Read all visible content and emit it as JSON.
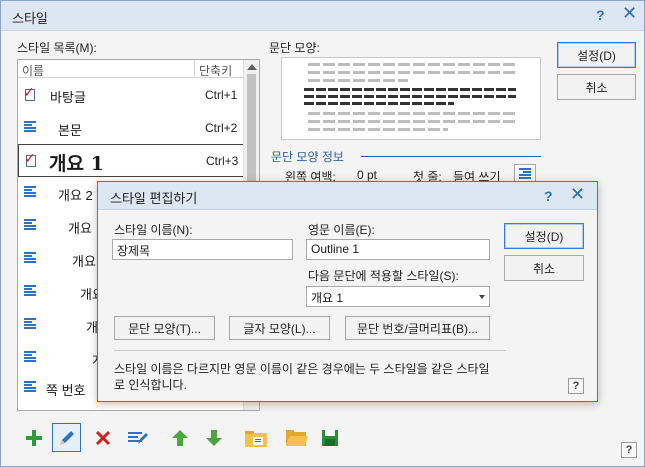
{
  "outer": {
    "title": "스타일",
    "help": "?",
    "close": "✕",
    "list_label": "스타일 목록(M):",
    "list_header_name": "이름",
    "list_header_key": "단축키",
    "preview_label": "문단 모양:",
    "ok_label": "설정(D)",
    "cancel_label": "취소",
    "info_title": "문단 모양 정보",
    "info_left_margin_label": "왼쪽 여백:",
    "info_left_margin_value": "0 pt",
    "info_first_line_label": "첫 줄:",
    "info_first_line_value": "들여 쓰기",
    "corner_help": "?",
    "styles": [
      {
        "name": "바탕글",
        "key": "Ctrl+1",
        "icon": "check-page-icon"
      },
      {
        "name": "본문",
        "key": "Ctrl+2",
        "icon": "paragraph-style-icon"
      },
      {
        "name": "개요 1",
        "key": "Ctrl+3",
        "icon": "check-page-icon"
      },
      {
        "name": "개요 2",
        "key": "",
        "icon": "paragraph-style-icon"
      },
      {
        "name": "개요",
        "key": "",
        "icon": "paragraph-style-icon"
      },
      {
        "name": "개요",
        "key": "",
        "icon": "paragraph-style-icon"
      },
      {
        "name": "개요",
        "key": "",
        "icon": "paragraph-style-icon"
      },
      {
        "name": "개",
        "key": "",
        "icon": "paragraph-style-icon"
      },
      {
        "name": "개",
        "key": "",
        "icon": "paragraph-style-icon"
      },
      {
        "name": "쪽 번호",
        "key": "",
        "icon": "paragraph-style-icon"
      }
    ],
    "toolbar": [
      "add-icon",
      "edit-pencil-icon",
      "delete-icon",
      "replace-style-icon",
      "move-up-icon",
      "move-down-icon",
      "import-style-icon",
      "open-folder-icon",
      "save-icon"
    ]
  },
  "inner": {
    "title": "스타일 편집하기",
    "help": "?",
    "close": "✕",
    "name_label": "스타일 이름(N):",
    "name_value": "장제목",
    "english_label": "영문 이름(E):",
    "english_value": "Outline 1",
    "next_label": "다음 문단에 적용할 스타일(S):",
    "next_value": "개요 1",
    "ok_label": "설정(D)",
    "cancel_label": "취소",
    "para_btn": "문단 모양(T)...",
    "char_btn": "글자 모양(L)...",
    "num_btn": "문단 번호/글머리표(B)...",
    "note": "스타일 이름은 다르지만 영문 이름이 같은 경우에는 두 스타일을 같은 스타일로 인식합니다.",
    "corner_help": "?"
  }
}
